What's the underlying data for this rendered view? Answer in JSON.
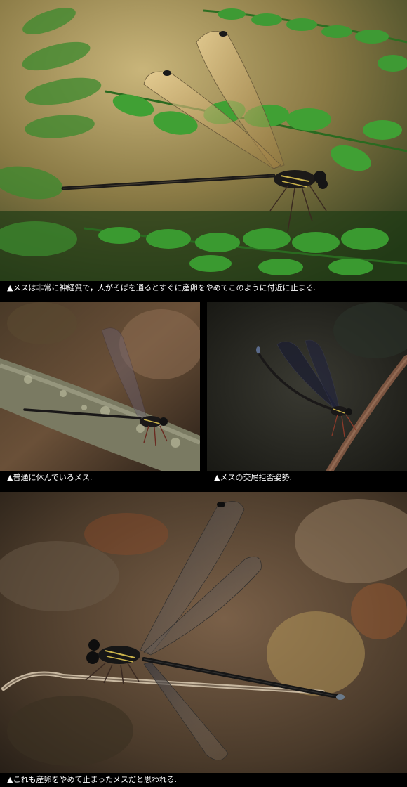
{
  "captions": {
    "top": "▲メスは非常に神経質で，人がそばを通るとすぐに産卵をやめてこのように付近に止まる.",
    "mid_left": "▲普通に休んでいるメス.",
    "mid_right": "▲メスの交尾拒否姿勢.",
    "bottom": "▲これも産卵をやめて止まったメスだと思われる."
  },
  "colors": {
    "background": "#000000",
    "caption_text": "#ffffff",
    "fern_green": "#2f8a2a",
    "damselfly_body": "#1c1a18",
    "damselfly_marking": "#c9b24a",
    "wing_tint": "#c8a86a"
  }
}
